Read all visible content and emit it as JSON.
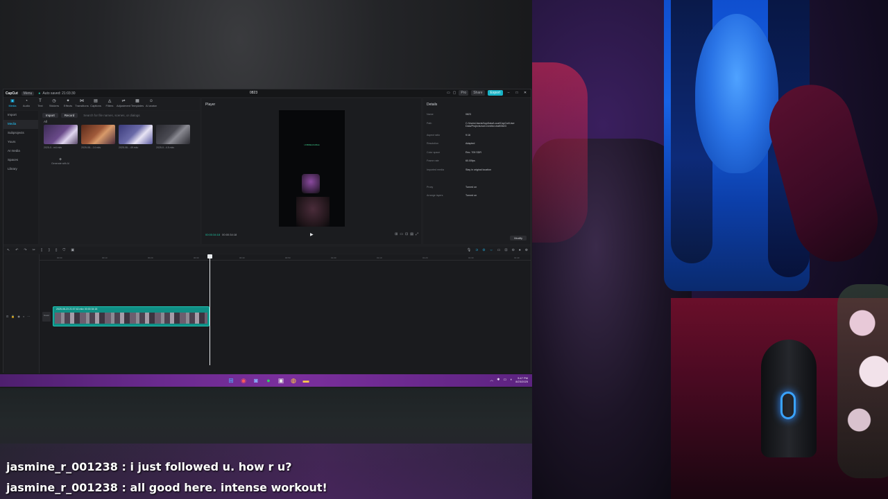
{
  "app": {
    "name": "CapCut",
    "menu_label": "Menu",
    "autosave": "Auto saved: 21:03:30",
    "project_title": "0823",
    "pro_label": "Pro",
    "share_label": "Share",
    "export_label": "Export"
  },
  "toolbar": [
    {
      "label": "Media",
      "icon": "media-icon"
    },
    {
      "label": "Audio",
      "icon": "audio-icon"
    },
    {
      "label": "Text",
      "icon": "text-icon"
    },
    {
      "label": "Stickers",
      "icon": "stickers-icon"
    },
    {
      "label": "Effects",
      "icon": "effects-icon"
    },
    {
      "label": "Transitions",
      "icon": "transitions-icon"
    },
    {
      "label": "Captions",
      "icon": "captions-icon"
    },
    {
      "label": "Filters",
      "icon": "filters-icon"
    },
    {
      "label": "Adjustment",
      "icon": "adjustment-icon"
    },
    {
      "label": "Templates",
      "icon": "templates-icon"
    },
    {
      "label": "AI avatar",
      "icon": "ai-avatar-icon"
    }
  ],
  "left_nav": [
    "Import",
    "Media",
    "Subprojects",
    "Yours",
    "AI media",
    "Spaces",
    "Library"
  ],
  "media": {
    "import_label": "Import",
    "record_label": "Record",
    "search_placeholder": "Search for file names, scenes, or dialogs",
    "filter_label": "All",
    "generate_label": "Generate with AI",
    "clips": [
      {
        "badge": "Added",
        "name": "2025-0...m4.mkv",
        "color": "#6a4a8a"
      },
      {
        "badge": "",
        "name": "2025-08-...14.mkv",
        "color": "#a05a3a"
      },
      {
        "badge": "",
        "name": "2025-08-...49.mkv",
        "color": "#6a6aa8"
      },
      {
        "badge": "",
        "name": "2025-0...4.5.mkv",
        "color": "#4a4a52"
      }
    ]
  },
  "player": {
    "title": "Player",
    "caption": "UNBREAKABLE",
    "time_current": "00:00:34:18",
    "time_total": "00:00:34:18"
  },
  "details": {
    "title": "Details",
    "rows": [
      {
        "k": "Name",
        "v": "0823"
      },
      {
        "k": "Path",
        "v": "C:/Users/Jasmi/AppData/Local/CapCut/User Data/Projects/com.lveditor.draft/0823"
      },
      {
        "k": "Aspect ratio",
        "v": "9:16"
      },
      {
        "k": "Resolution",
        "v": "Adapted"
      },
      {
        "k": "Color space",
        "v": "Rec. 709 SDR"
      },
      {
        "k": "Frame rate",
        "v": "60.00fps"
      },
      {
        "k": "Imported media",
        "v": "Stay in original location"
      },
      {
        "k": "",
        "v": ""
      },
      {
        "k": "Proxy",
        "v": "Turned on"
      },
      {
        "k": "Arrange layers",
        "v": "Turned on"
      }
    ],
    "modify_label": "Modify"
  },
  "timeline": {
    "ruler": [
      "00:00",
      "00:10",
      "00:20",
      "00:30",
      "00:40",
      "00:50",
      "01:00",
      "01:10",
      "01:20",
      "01:30",
      "01:40"
    ],
    "clip_label": "2025-08-23 21:07:42.mkv  00:00:34:18",
    "cover_label": "Cover"
  },
  "taskbar": {
    "time": "9:47 PM",
    "date": "8/23/2025"
  },
  "chat": [
    {
      "user": "jasmine_r_001238",
      "message": "i just followed u. how r u?"
    },
    {
      "user": "jasmine_r_001238",
      "message": "all good here. intense workout!"
    }
  ]
}
